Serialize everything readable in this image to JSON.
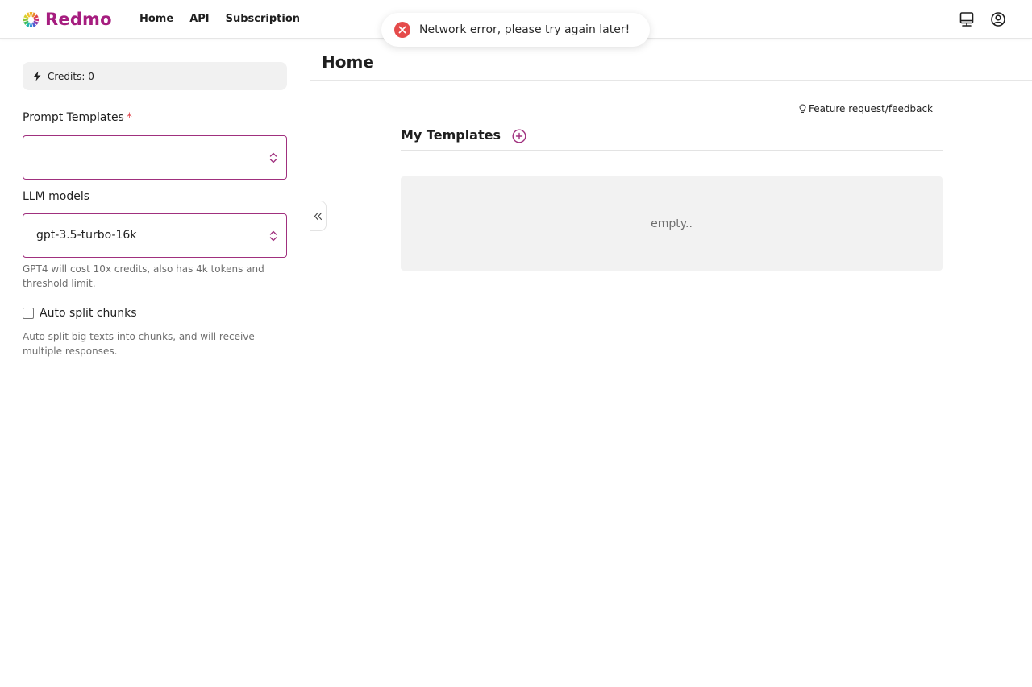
{
  "header": {
    "brand": "Redmo",
    "brand_color": "#a61d7f",
    "nav": [
      "Home",
      "API",
      "Subscription"
    ],
    "icons": [
      "logo-flower-icon",
      "book-icon",
      "user-circle-icon"
    ]
  },
  "toast": {
    "type": "error",
    "message": "Network error, please try again later!",
    "icon": "error-x-icon",
    "color": "#e54b4b"
  },
  "sidebar": {
    "credits_label": "Credits: 0",
    "credits_icon": "bolt-icon",
    "prompt_templates": {
      "label": "Prompt Templates",
      "required_mark": "*",
      "value": ""
    },
    "llm_models": {
      "label": "LLM models",
      "value": "gpt-3.5-turbo-16k",
      "hint": "GPT4 will cost 10x credits, also has 4k tokens and threshold limit."
    },
    "auto_split": {
      "label": "Auto split chunks",
      "checked": false,
      "hint": "Auto split big texts into chunks, and will receive multiple responses."
    }
  },
  "main": {
    "title": "Home",
    "feedback_link": "Feature request/feedback",
    "templates_title": "My Templates",
    "empty_text": "empty.."
  }
}
